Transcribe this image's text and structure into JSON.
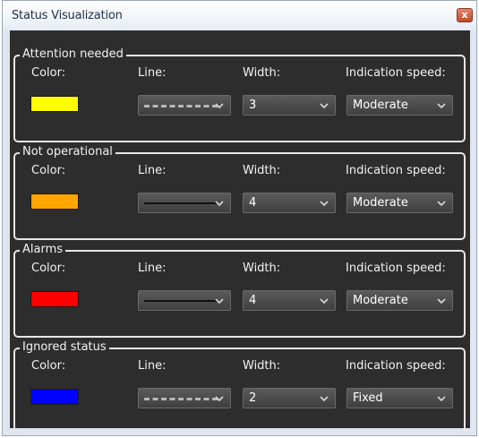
{
  "window": {
    "title": "Status Visualization",
    "close_glyph": "x"
  },
  "labels": {
    "color": "Color:",
    "line": "Line:",
    "width": "Width:",
    "speed": "Indication speed:"
  },
  "groups": [
    {
      "title": "Attention needed",
      "color": "#ffff00",
      "line_style": "dashed",
      "width": "3",
      "speed": "Moderate"
    },
    {
      "title": "Not operational",
      "color": "#ffa500",
      "line_style": "solid",
      "width": "4",
      "speed": "Moderate"
    },
    {
      "title": "Alarms",
      "color": "#ff0000",
      "line_style": "solid",
      "width": "4",
      "speed": "Moderate"
    },
    {
      "title": "Ignored status",
      "color": "#0000ff",
      "line_style": "dashed",
      "width": "2",
      "speed": "Fixed"
    }
  ],
  "icons": {
    "dropdown": "chevron-down-icon",
    "close": "close-icon"
  }
}
